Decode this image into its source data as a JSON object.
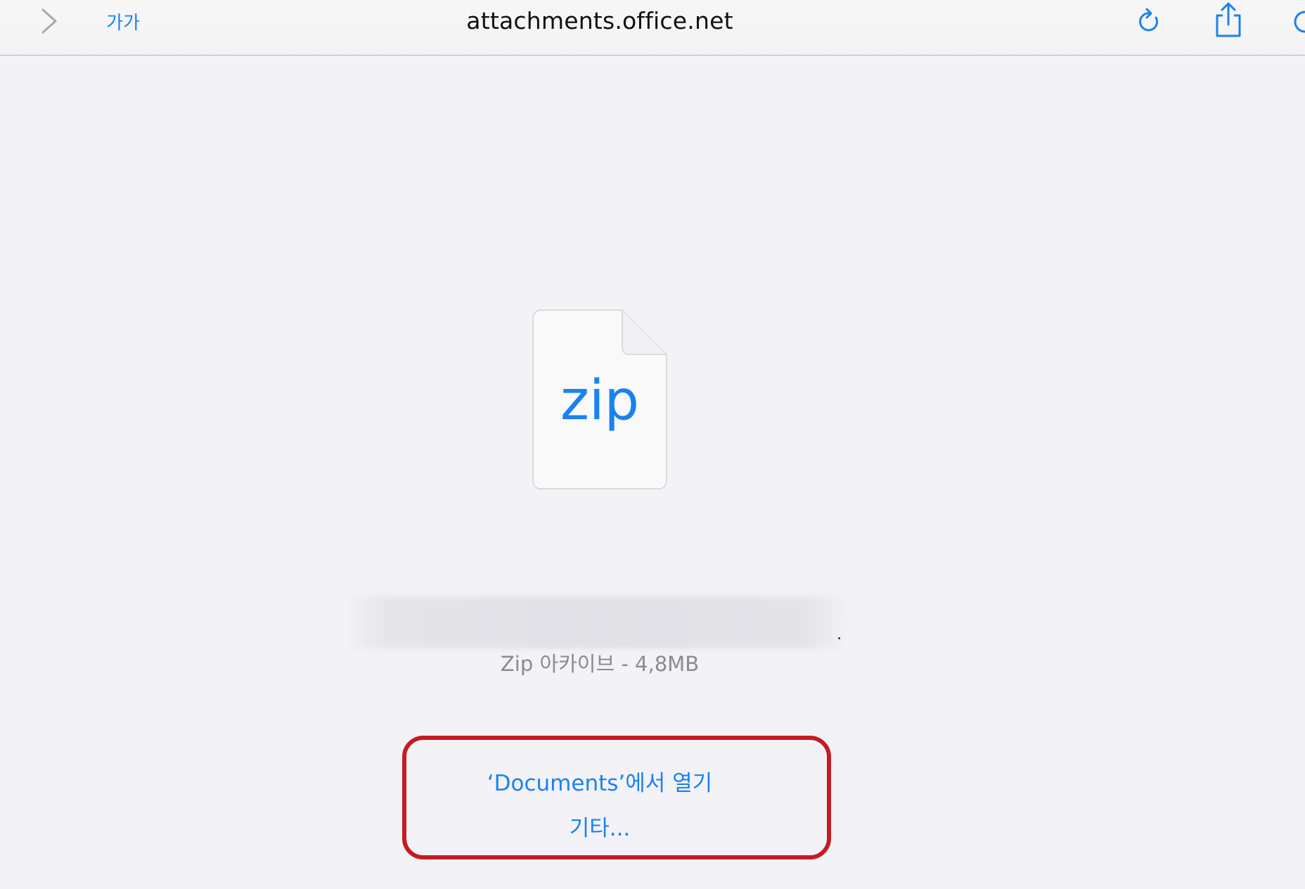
{
  "toolbar": {
    "forward_icon": "chevron-right-icon",
    "reader_label": "가가",
    "url": "attachments.office.net",
    "reload_icon": "reload-icon",
    "share_icon": "share-icon",
    "tabs_icon": "tabs-icon",
    "accent_color": "#1a82f0"
  },
  "file": {
    "extension": "zip",
    "info": "Zip 아카이브 - 4,8MB"
  },
  "actions": {
    "open_in": "‘Documents’에서 열기",
    "more": "기타..."
  },
  "highlight_color": "#c41c22"
}
